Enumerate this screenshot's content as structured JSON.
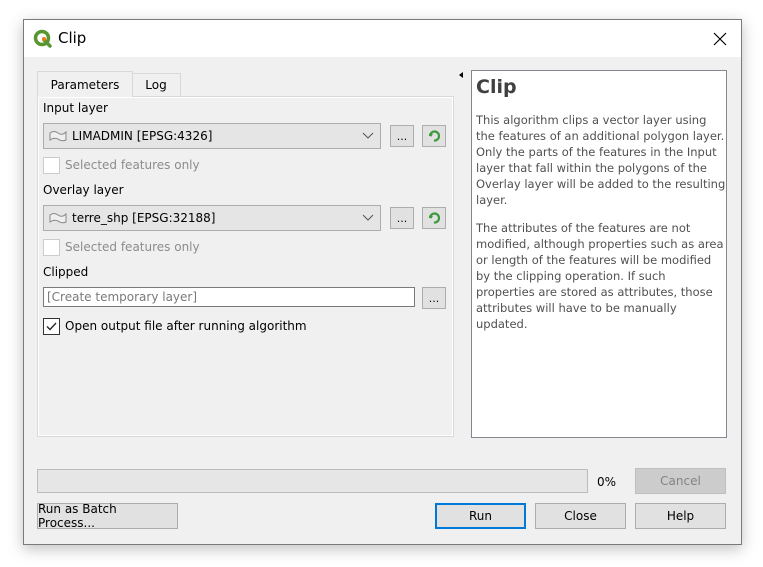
{
  "window": {
    "title": "Clip",
    "app_icon": "qgis-logo-icon",
    "close_icon": "close-icon"
  },
  "tabs": [
    {
      "label": "Parameters",
      "active": true
    },
    {
      "label": "Log",
      "active": false
    }
  ],
  "parameters": {
    "input_layer": {
      "label": "Input layer",
      "value": "LIMADMIN [EPSG:4326]",
      "selected_only_label": "Selected features only",
      "selected_only_checked": false,
      "browse_label": "..."
    },
    "overlay_layer": {
      "label": "Overlay layer",
      "value": "terre_shp [EPSG:32188]",
      "selected_only_label": "Selected features only",
      "selected_only_checked": false,
      "browse_label": "..."
    },
    "clipped": {
      "label": "Clipped",
      "placeholder": "[Create temporary layer]",
      "value": "",
      "browse_label": "..."
    },
    "open_output": {
      "label": "Open output file after running algorithm",
      "checked": true
    }
  },
  "help": {
    "title": "Clip",
    "paragraphs": [
      "This algorithm clips a vector layer using the features of an additional polygon layer. Only the parts of the features in the Input layer that fall within the polygons of the Overlay layer will be added to the resulting layer.",
      "The attributes of the features are not modified, although properties such as area or length of the features will be modified by the clipping operation. If such properties are stored as attributes, those attributes will have to be manually updated."
    ]
  },
  "progress": {
    "value_percent": 0,
    "label": "0%"
  },
  "buttons": {
    "cancel": "Cancel",
    "batch": "Run as Batch Process...",
    "run": "Run",
    "close": "Close",
    "help": "Help"
  },
  "colors": {
    "accent": "#0078d7",
    "qgis_green": "#589632",
    "qgis_orange": "#ee7913"
  }
}
